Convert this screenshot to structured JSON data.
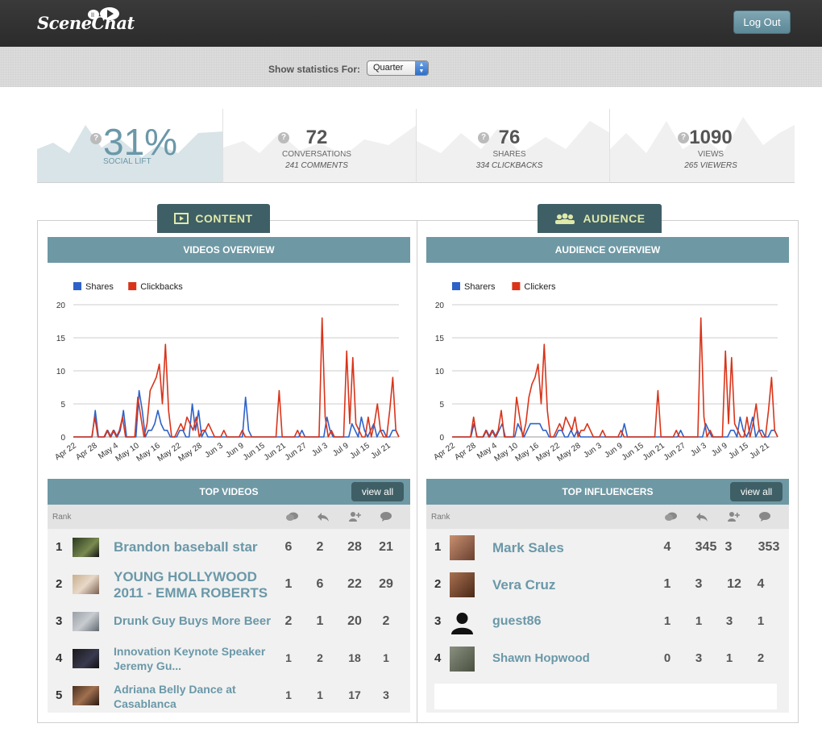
{
  "app": {
    "logo": "SceneChat",
    "logout_label": "Log Out"
  },
  "filter": {
    "label": "Show statistics For:",
    "selected": "Quarter"
  },
  "stats": [
    {
      "value": "31%",
      "label": "SOCIAL LIFT",
      "sub": ""
    },
    {
      "value": "72",
      "label": "CONVERSATIONS",
      "sub": "241 COMMENTS"
    },
    {
      "value": "76",
      "label": "SHARES",
      "sub": "334 CLICKBACKS"
    },
    {
      "value": "1090",
      "label": "VIEWS",
      "sub": "265 VIEWERS"
    }
  ],
  "tabs": {
    "content": "CONTENT",
    "audience": "AUDIENCE"
  },
  "colors": {
    "shares": "#2e62c9",
    "clicks": "#d9341a",
    "accent": "#6e98a4",
    "tab": "#3f5f66",
    "tab_text": "#dfe9a9"
  },
  "chart_data": [
    {
      "type": "line",
      "title": "VIDEOS OVERVIEW",
      "ylim": [
        0,
        20
      ],
      "yticks": [
        "0",
        "5",
        "10",
        "15",
        "20"
      ],
      "xticks": [
        "Apr 22",
        "Apr 28",
        "May 4",
        "May 10",
        "May 16",
        "May 22",
        "May 28",
        "Jun 3",
        "Jun 9",
        "Jun 15",
        "Jun 21",
        "Jun 27",
        "Jul 3",
        "Jul 9",
        "Jul 15",
        "Jul 21"
      ],
      "grid": true,
      "legend": "top-left",
      "series": [
        {
          "name": "Shares",
          "values": [
            0,
            0,
            0,
            0,
            0,
            0,
            0,
            4,
            0,
            0,
            0,
            1,
            0,
            1,
            0,
            1,
            4,
            0,
            0,
            0,
            0,
            7,
            4,
            0,
            1,
            1,
            2,
            4,
            2,
            1,
            1,
            0,
            0,
            0,
            1,
            1,
            0,
            0,
            5,
            1,
            4,
            0,
            1,
            0,
            0,
            0,
            0,
            0,
            0,
            0,
            0,
            0,
            0,
            0,
            0,
            6,
            1,
            0,
            0,
            0,
            0,
            0,
            0,
            0,
            0,
            0,
            0,
            0,
            0,
            0,
            0,
            0,
            0,
            1,
            0,
            0,
            0,
            0,
            0,
            0,
            0,
            3,
            1,
            0,
            0,
            0,
            0,
            0,
            0,
            2,
            1,
            0,
            3,
            1,
            0,
            1,
            2,
            0,
            1,
            1,
            0,
            0,
            1,
            1,
            0
          ],
          "color": "#2e62c9"
        },
        {
          "name": "Clickbacks",
          "values": [
            0,
            0,
            0,
            0,
            0,
            0,
            0,
            3,
            0,
            0,
            0,
            1,
            0,
            1,
            0,
            1,
            3,
            0,
            0,
            0,
            0,
            6,
            3,
            0,
            2,
            7,
            8,
            9,
            11,
            5,
            14,
            4,
            0,
            0,
            1,
            2,
            1,
            3,
            2,
            1,
            3,
            0,
            1,
            1,
            2,
            1,
            0,
            0,
            0,
            1,
            0,
            0,
            0,
            0,
            0,
            1,
            0,
            0,
            0,
            0,
            0,
            0,
            0,
            0,
            0,
            0,
            0,
            7,
            0,
            0,
            0,
            0,
            0,
            1,
            0,
            0,
            0,
            0,
            0,
            0,
            0,
            18,
            3,
            0,
            1,
            0,
            0,
            0,
            0,
            13,
            2,
            12,
            2,
            1,
            0,
            0,
            3,
            0,
            2,
            5,
            1,
            0,
            0,
            4,
            9,
            1,
            0
          ],
          "color": "#d9341a"
        }
      ]
    },
    {
      "type": "line",
      "title": "AUDIENCE OVERVIEW",
      "ylim": [
        0,
        20
      ],
      "yticks": [
        "0",
        "5",
        "10",
        "15",
        "20"
      ],
      "xticks": [
        "Apr 22",
        "Apr 28",
        "May 4",
        "May 10",
        "May 16",
        "May 22",
        "May 28",
        "Jun 3",
        "Jun 9",
        "Jun 15",
        "Jun 21",
        "Jun 27",
        "Jul 3",
        "Jul 9",
        "Jul 15",
        "Jul 21"
      ],
      "grid": true,
      "legend": "top-left",
      "series": [
        {
          "name": "Sharers",
          "values": [
            0,
            0,
            0,
            0,
            0,
            0,
            0,
            2,
            0,
            0,
            0,
            1,
            0,
            1,
            0,
            1,
            2,
            0,
            0,
            0,
            0,
            2,
            1,
            0,
            1,
            2,
            2,
            2,
            2,
            1,
            1,
            0,
            0,
            0,
            1,
            1,
            0,
            0,
            1,
            0,
            1,
            0,
            0,
            0,
            0,
            0,
            0,
            0,
            0,
            0,
            0,
            0,
            0,
            0,
            0,
            2,
            0,
            0,
            0,
            0,
            0,
            0,
            0,
            0,
            0,
            0,
            0,
            0,
            0,
            0,
            0,
            0,
            0,
            1,
            0,
            0,
            0,
            0,
            0,
            0,
            0,
            2,
            1,
            0,
            0,
            0,
            0,
            0,
            0,
            1,
            1,
            0,
            3,
            1,
            0,
            1,
            3,
            0,
            1,
            1,
            0,
            0,
            1,
            1,
            0
          ],
          "color": "#2e62c9"
        },
        {
          "name": "Clickers",
          "values": [
            0,
            0,
            0,
            0,
            0,
            0,
            0,
            3,
            0,
            0,
            0,
            1,
            0,
            1,
            0,
            1,
            4,
            0,
            0,
            0,
            0,
            6,
            3,
            0,
            2,
            6,
            8,
            9,
            11,
            5,
            14,
            4,
            0,
            0,
            1,
            2,
            1,
            3,
            2,
            1,
            3,
            0,
            1,
            1,
            2,
            1,
            0,
            0,
            0,
            1,
            0,
            0,
            0,
            0,
            0,
            1,
            0,
            0,
            0,
            0,
            0,
            0,
            0,
            0,
            0,
            0,
            0,
            7,
            0,
            0,
            0,
            0,
            0,
            1,
            0,
            0,
            0,
            0,
            0,
            0,
            0,
            18,
            3,
            0,
            1,
            0,
            0,
            0,
            0,
            13,
            2,
            12,
            2,
            1,
            0,
            0,
            3,
            0,
            2,
            5,
            1,
            0,
            0,
            4,
            9,
            1,
            0
          ],
          "color": "#d9341a"
        }
      ]
    }
  ],
  "top_videos": {
    "title": "TOP VIDEOS",
    "view_all": "view all",
    "rank_label": "Rank",
    "icons": [
      "conversations-icon",
      "shares-icon",
      "clickbacks-icon",
      "comments-icon"
    ],
    "rows": [
      {
        "rank": "1",
        "title": "Brandon baseball star",
        "vals": [
          "6",
          "2",
          "28",
          "21"
        ]
      },
      {
        "rank": "2",
        "title": "YOUNG HOLLYWOOD 2011 - EMMA ROBERTS",
        "vals": [
          "1",
          "6",
          "22",
          "29"
        ]
      },
      {
        "rank": "3",
        "title": "Drunk Guy Buys More Beer",
        "vals": [
          "2",
          "1",
          "20",
          "2"
        ]
      },
      {
        "rank": "4",
        "title": "Innovation Keynote Speaker Jeremy Gu...",
        "vals": [
          "1",
          "2",
          "18",
          "1"
        ]
      },
      {
        "rank": "5",
        "title": "Adriana Belly Dance at Casablanca",
        "vals": [
          "1",
          "1",
          "17",
          "3"
        ]
      }
    ]
  },
  "top_influencers": {
    "title": "TOP INFLUENCERS",
    "view_all": "view all",
    "rank_label": "Rank",
    "icons": [
      "conversations-icon",
      "shares-icon",
      "clickbacks-icon",
      "comments-icon"
    ],
    "rows": [
      {
        "rank": "1",
        "name": "Mark Sales",
        "vals": [
          "4",
          "345",
          "3",
          "353"
        ]
      },
      {
        "rank": "2",
        "name": "Vera Cruz",
        "vals": [
          "1",
          "3",
          "12",
          "4"
        ]
      },
      {
        "rank": "3",
        "name": "guest86",
        "vals": [
          "1",
          "1",
          "3",
          "1"
        ]
      },
      {
        "rank": "4",
        "name": "Shawn Hopwood",
        "vals": [
          "0",
          "3",
          "1",
          "2"
        ]
      }
    ]
  }
}
